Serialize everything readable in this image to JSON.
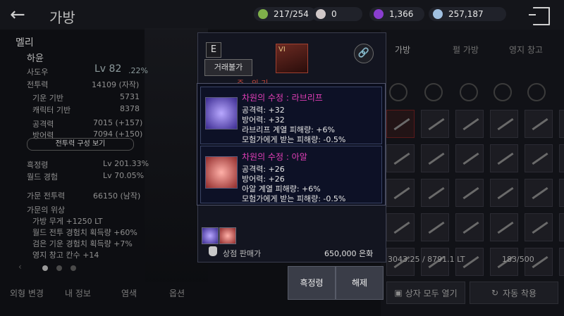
{
  "header": {
    "title": "가방",
    "currencies": [
      {
        "icon": "energy-icon",
        "value": "217/254",
        "color": "#7fb04a"
      },
      {
        "icon": "pearl-icon",
        "value": "0",
        "color": "#d0c8c8"
      },
      {
        "icon": "crystal-icon",
        "value": "1,366",
        "color": "#8a3ed0"
      },
      {
        "icon": "silver-icon",
        "value": "257,187",
        "color": "#a0c0e0"
      }
    ]
  },
  "character": {
    "family": "멜리",
    "name": "하윤",
    "class": "사도우",
    "level": "Lv 82",
    "level_pct": ".22%",
    "combat_label": "전투력",
    "combat_value": "14109 (자작)",
    "base_label": "기운 기반",
    "base_value": "5731",
    "char_base_label": "캐릭터 기반",
    "char_base_value": "8378",
    "attack_label": "공격력",
    "attack_value": "7015 (+157)",
    "defense_label": "방어력",
    "defense_value": "7094 (+150)",
    "combat_config_button": "전투력 구성 보기",
    "black_spirit_label": "흑정령",
    "black_spirit_value": "Lv 201.33%",
    "world_exp_label": "월드 경험",
    "world_exp_value": "Lv 70.05%",
    "family_combat_label": "가문 전투력",
    "family_combat_value": "66150 (남작)",
    "family_bonus_label": "가문의 위상",
    "bonus_lines": [
      "가방 무게 +1250 LT",
      "월드 전투 경험치 획득량 +60%",
      "검은 기운 경험치 획득량 +7%",
      "영지 창고 칸수 +14"
    ]
  },
  "left_tabs": [
    "외형 변경",
    "내 정보",
    "염색",
    "옵션"
  ],
  "inventory": {
    "tabs": [
      "가방",
      "펄 가방",
      "영지 창고"
    ],
    "weight": "3043.25 / 8791.1 LT",
    "slots": "183/500",
    "open_all_button": "상자 모두 열기",
    "auto_equip_button": "자동 착용"
  },
  "popup": {
    "grade": "E",
    "trade_badge": "거래불가",
    "item_grade_roman": "VI",
    "subtitle": "주...의 기...",
    "gems": [
      {
        "title": "차원의 수정 : 라브리프",
        "lines": [
          "공격력: +32",
          "방어력: +32",
          "라브리프 계열 피해량: +6%",
          "모험가에게 받는 피해량: -0.5%"
        ],
        "color": "#6a4ad0"
      },
      {
        "title": "차원의 수정 : 아알",
        "lines": [
          "공격력: +26",
          "방어력: +26",
          "아알 계열 피해량: +6%",
          "모험가에게 받는 피해량: -0.5%"
        ],
        "color": "#c0403a"
      }
    ],
    "sale_label": "상점 판매가",
    "sale_value": "650,000 은화",
    "buttons": [
      "흑정령",
      "해제"
    ]
  }
}
